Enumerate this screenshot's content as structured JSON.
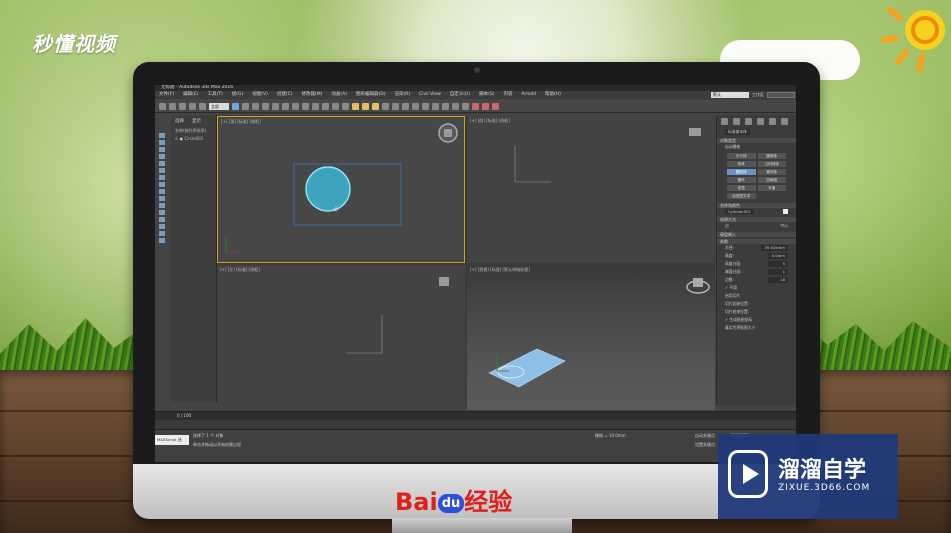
{
  "watermark": {
    "brand": "秒懂视频"
  },
  "app": {
    "title": "无标题 - Autodesk 3ds Max 2016",
    "menu": [
      "文件(F)",
      "编辑(E)",
      "工具(T)",
      "组(G)",
      "视图(V)",
      "创建(C)",
      "修改器(M)",
      "动画(A)",
      "图形编辑器(D)",
      "渲染(R)",
      "Civil View",
      "自定义(U)",
      "脚本(S)",
      "内容",
      "Arnold",
      "帮助(H)"
    ],
    "workspace_label": "工作区",
    "workspace_value": "默认",
    "toolbar_select": "全部",
    "scene_explorer": {
      "tabs": [
        "选择",
        "显示"
      ],
      "rows": [
        "名称(按升序排序)",
        "⊙ ● Circle001"
      ]
    },
    "viewports": [
      {
        "label": "[+] [顶] [标准] [线框]"
      },
      {
        "label": "[+] [前] [标准] [线框]"
      },
      {
        "label": "[+] [左] [标准] [线框]"
      },
      {
        "label": "[+] [透视] [标准] [默认明暗处理]"
      }
    ],
    "command_panel": {
      "category": "标准基本体",
      "section_object_type": "对象类型",
      "autogrid": "自动栅格",
      "buttons": [
        "长方体",
        "圆锥体",
        "球体",
        "几何球体",
        "圆柱体",
        "管状体",
        "圆环",
        "四棱锥",
        "茶壶",
        "平面",
        "加强型文本"
      ],
      "active_button": "圆柱体",
      "section_name_color": "名称和颜色",
      "object_name": "Cylinder001",
      "section_creation": "创建方法",
      "creation_options": [
        "边",
        "中心"
      ],
      "section_keyboard": "键盘输入",
      "section_params": "参数",
      "params": [
        {
          "label": "半径:",
          "value": "39.925mm"
        },
        {
          "label": "高度:",
          "value": "0.0mm"
        },
        {
          "label": "高度分段:",
          "value": "5"
        },
        {
          "label": "端面分段:",
          "value": "1"
        },
        {
          "label": "边数:",
          "value": "18"
        }
      ],
      "checks": [
        "✓ 平滑",
        "启用切片",
        "切片起始位置:",
        "切片结束位置:",
        "✓ 生成贴图坐标",
        "真实世界贴图大小"
      ]
    },
    "timeline": {
      "frame": "0 / 100"
    },
    "status": {
      "maxscript": "MAXScript 迷",
      "selected": "选择了 1 个 对象",
      "prompt": "单击并拖动以开始创建过程",
      "grid": "栅格 = 10.0mm",
      "autokey": "自动关键点",
      "setkey": "设置关键点",
      "selection_set": "选定对象"
    }
  },
  "baidu": {
    "logo_a": "Bai",
    "logo_du": "du",
    "logo_b": "经验"
  },
  "zixue": {
    "name": "溜溜自学",
    "url": "ZIXUE.3D66.COM"
  }
}
